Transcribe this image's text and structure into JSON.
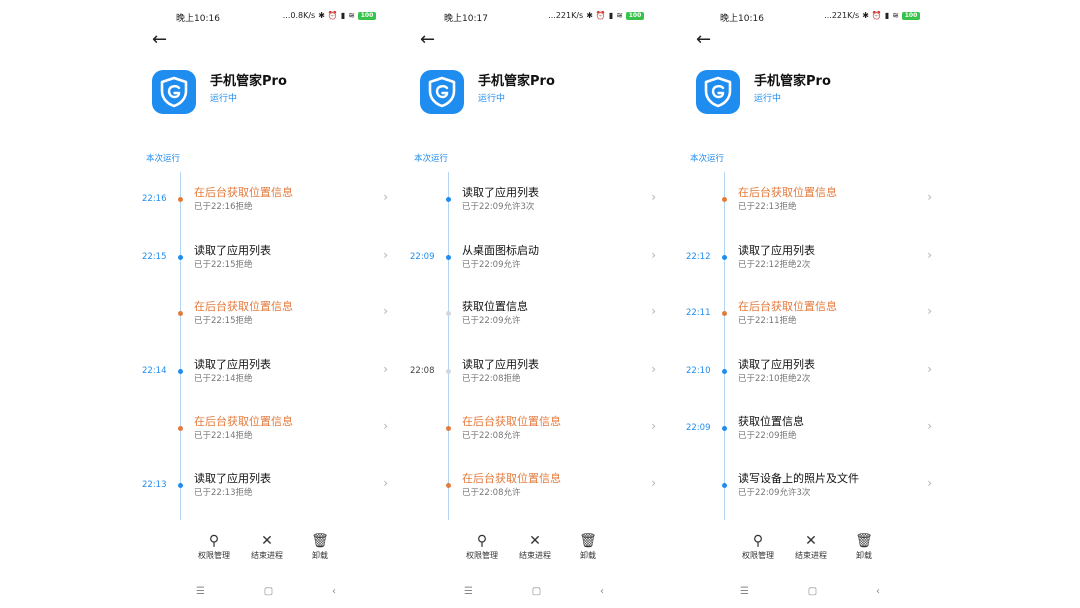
{
  "colors": {
    "accent": "#1f8cf0",
    "warning": "#e57a3c"
  },
  "phones": [
    {
      "status": {
        "time": "晚上10:16",
        "net": "...0.8K/s",
        "battery": "100"
      },
      "app": {
        "name": "手机管家Pro",
        "status": "运行中"
      },
      "section": "本次运行",
      "rows": [
        {
          "time": "22:16",
          "title": "在后台获取位置信息",
          "sub": "已于22:16拒绝",
          "warn": true
        },
        {
          "time": "22:15",
          "title": "读取了应用列表",
          "sub": "已于22:15拒绝",
          "warn": false
        },
        {
          "time": "",
          "title": "在后台获取位置信息",
          "sub": "已于22:15拒绝",
          "warn": true
        },
        {
          "time": "22:14",
          "title": "读取了应用列表",
          "sub": "已于22:14拒绝",
          "warn": false
        },
        {
          "time": "",
          "title": "在后台获取位置信息",
          "sub": "已于22:14拒绝",
          "warn": true
        },
        {
          "time": "22:13",
          "title": "读取了应用列表",
          "sub": "已于22:13拒绝",
          "warn": false
        }
      ]
    },
    {
      "status": {
        "time": "晚上10:17",
        "net": "...221K/s",
        "battery": "100"
      },
      "app": {
        "name": "手机管家Pro",
        "status": "运行中"
      },
      "section": "本次运行",
      "rows": [
        {
          "time": "",
          "title": "读取了应用列表",
          "sub": "已于22:09允许3次",
          "warn": false
        },
        {
          "time": "22:09",
          "title": "从桌面图标启动",
          "sub": "已于22:09允许",
          "warn": false
        },
        {
          "time": "",
          "title": "获取位置信息",
          "sub": "已于22:09允许",
          "warn": false,
          "light": true
        },
        {
          "time": "22:08",
          "title": "读取了应用列表",
          "sub": "已于22:08拒绝",
          "warn": false,
          "light": true
        },
        {
          "time": "",
          "title": "在后台获取位置信息",
          "sub": "已于22:08允许",
          "warn": true
        },
        {
          "time": "",
          "title": "在后台获取位置信息",
          "sub": "已于22:08允许",
          "warn": true
        }
      ]
    },
    {
      "status": {
        "time": "晚上10:16",
        "net": "...221K/s",
        "battery": "100"
      },
      "app": {
        "name": "手机管家Pro",
        "status": "运行中"
      },
      "section": "本次运行",
      "rows": [
        {
          "time": "",
          "title": "在后台获取位置信息",
          "sub": "已于22:13拒绝",
          "warn": true
        },
        {
          "time": "22:12",
          "title": "读取了应用列表",
          "sub": "已于22:12拒绝2次",
          "warn": false
        },
        {
          "time": "22:11",
          "title": "在后台获取位置信息",
          "sub": "已于22:11拒绝",
          "warn": true
        },
        {
          "time": "22:10",
          "title": "读取了应用列表",
          "sub": "已于22:10拒绝2次",
          "warn": false
        },
        {
          "time": "22:09",
          "title": "获取位置信息",
          "sub": "已于22:09拒绝",
          "warn": false
        },
        {
          "time": "",
          "title": "读写设备上的照片及文件",
          "sub": "已于22:09允许3次",
          "warn": false
        }
      ]
    }
  ],
  "actions": [
    {
      "label": "权限管理",
      "icon": "key-icon"
    },
    {
      "label": "结束进程",
      "icon": "close-icon"
    },
    {
      "label": "卸载",
      "icon": "trash-icon"
    }
  ]
}
